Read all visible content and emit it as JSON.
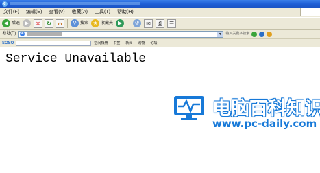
{
  "window": {
    "icon_letter": "e"
  },
  "menu": {
    "items": [
      "文件(F)",
      "编辑(E)",
      "查看(V)",
      "收藏(A)",
      "工具(T)",
      "帮助(H)"
    ]
  },
  "toolbar": {
    "back_label": "后退",
    "search_label": "搜索",
    "favorites_label": "收藏夹"
  },
  "address": {
    "label": "地址(D)",
    "search_placeholder": "输入关键字搜索"
  },
  "links_bar": {
    "logo": "SOSO",
    "items": [
      "空间相册",
      "书签",
      "新闻",
      "购物",
      "论坛"
    ]
  },
  "page": {
    "error_message": "Service Unavailable"
  },
  "watermark": {
    "title": "电脑百科知识",
    "url": "www.pc-daily.com"
  },
  "colors": {
    "titlebar": "#1f5fd6",
    "chrome": "#ece9d8",
    "watermark_blue": "#1779d8"
  }
}
